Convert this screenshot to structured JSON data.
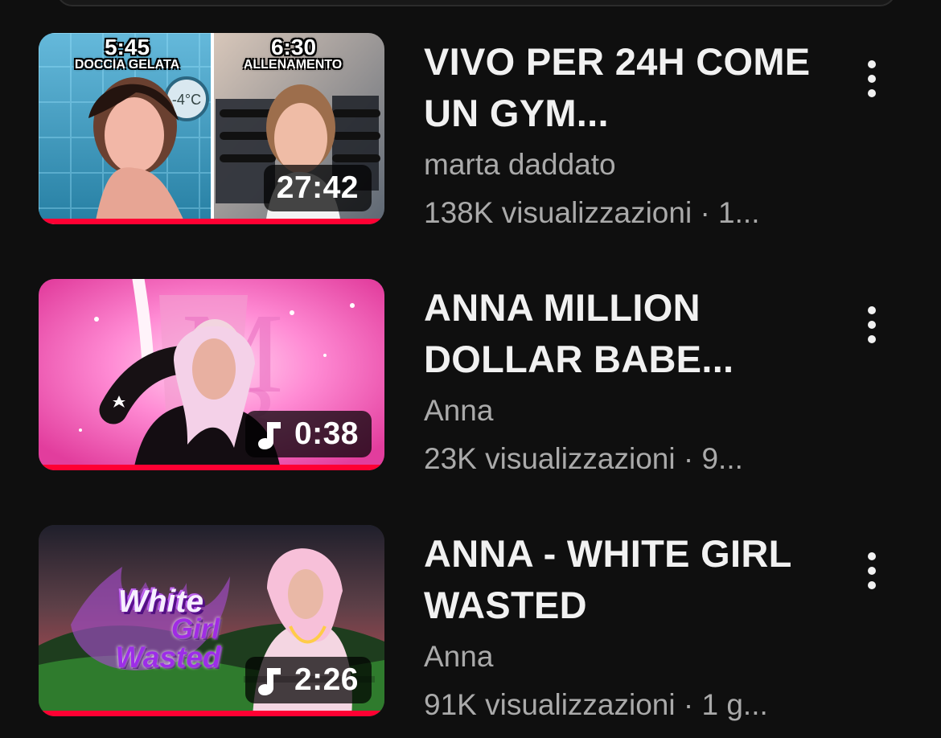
{
  "colors": {
    "background": "#0f0f0f",
    "title_text": "#f1f1f1",
    "secondary_text": "#aaaaaa",
    "progress": "#ff0033"
  },
  "videos": [
    {
      "title": "VIVO PER 24H COME UN GYM...",
      "channel": "marta daddato",
      "stats": "138K visualizzazioni · 1...",
      "duration": "27:42",
      "is_music": false,
      "watched_fraction": 1.0,
      "thumbnail_text": {
        "left_time": "5:45",
        "left_caption": "DOCCIA GELATA",
        "right_time": "6:30",
        "right_caption": "ALLENAMENTO",
        "gauge": "-4°C"
      },
      "menu_icon": "more-vertical-icon"
    },
    {
      "title": "ANNA MILLION DOLLAR BABE...",
      "channel": "Anna",
      "stats": "23K visualizzazioni · 9...",
      "duration": "0:38",
      "is_music": true,
      "watched_fraction": 1.0,
      "menu_icon": "more-vertical-icon"
    },
    {
      "title": "ANNA - WHITE GIRL WASTED",
      "channel": "Anna",
      "stats": "91K visualizzazioni · 1 g...",
      "duration": "2:26",
      "is_music": true,
      "watched_fraction": 1.0,
      "thumbnail_text": {
        "logo_line1": "White",
        "logo_line2": "Girl",
        "logo_line3": "Wasted"
      },
      "menu_icon": "more-vertical-icon"
    }
  ]
}
